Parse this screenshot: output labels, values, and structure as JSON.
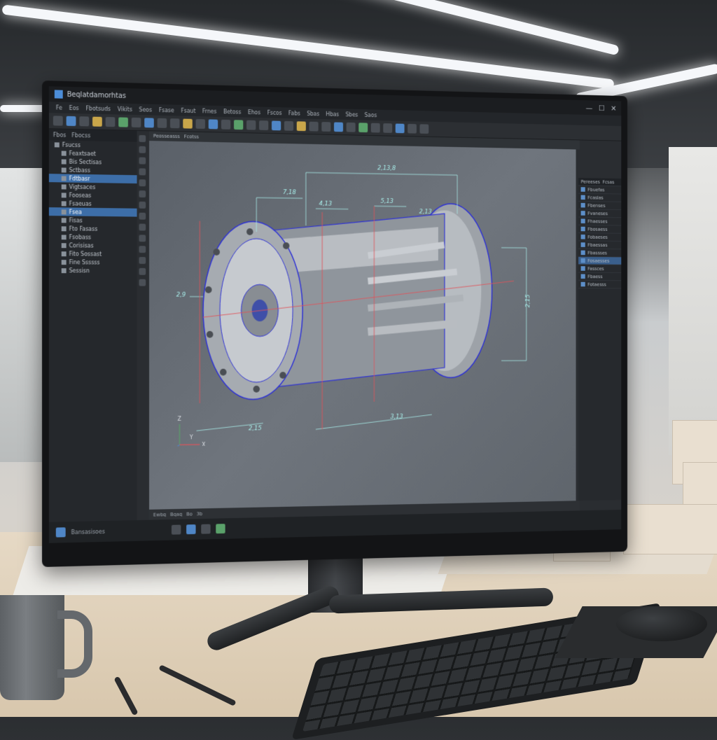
{
  "window": {
    "title": "Beqlatdamorhtas",
    "controls": [
      "—",
      "☐",
      "✕"
    ]
  },
  "menu": [
    "Fe",
    "Eos",
    "Fbotsuds",
    "Vikits",
    "Seos",
    "Fsase",
    "Fsaut",
    "Frnes",
    "Betoss",
    "Ehos",
    "Fscos",
    "Fabs",
    "Sbas",
    "Hbas",
    "Sbes",
    "Saos"
  ],
  "left_panel": {
    "tabs": [
      "Fbos",
      "Fbocss"
    ],
    "header": "Fsucss",
    "items": [
      {
        "label": "Feaxtsaet",
        "selected": false
      },
      {
        "label": "Bis Sectisas",
        "selected": false
      },
      {
        "label": "Sctbass",
        "selected": false
      },
      {
        "label": "Fdtbasr",
        "selected": true
      },
      {
        "label": "Vigtsaces",
        "selected": false
      },
      {
        "label": "Fooseas",
        "selected": false
      },
      {
        "label": "Fsaeuas",
        "selected": false
      },
      {
        "label": "Fsea",
        "selected": true
      },
      {
        "label": "Fisas",
        "selected": false
      },
      {
        "label": "Fto Fasass",
        "selected": false
      },
      {
        "label": "Fsobass",
        "selected": false
      },
      {
        "label": "Corisisas",
        "selected": false
      },
      {
        "label": "Fito Sossast",
        "selected": false
      },
      {
        "label": "Fine Ssssss",
        "selected": false
      },
      {
        "label": "Sessisn",
        "selected": false
      }
    ]
  },
  "viewport": {
    "tabs": [
      "Peosseasss",
      "Fcotss"
    ],
    "dimensions": [
      "2,13,8",
      "7,18",
      "4,13",
      "5,13",
      "2,13",
      "2,9",
      "2,15",
      "3,13",
      "2,15"
    ],
    "axis": [
      "Z",
      "X",
      "Y"
    ],
    "status": [
      "Ewbq",
      "Bqaq",
      "Bo",
      "3b"
    ]
  },
  "right_panel": {
    "tabs": [
      "Pereeses",
      "Fcsas"
    ],
    "rows": [
      "Fbuefas",
      "Fcaslas",
      "Fbenses",
      "Fvaneses",
      "Fhaesses",
      "Fbosaess",
      "Fobaeses",
      "Fbaessas",
      "Fbassses",
      "Fosaesses",
      "Fassces",
      "Fbaess",
      "Fotaesss"
    ]
  },
  "statusbar": {
    "left": "Bansasisoes"
  },
  "colors": {
    "accent": "#3d6ea8",
    "model_outline": "#2b2fd6",
    "dimension": "#a9f0ec",
    "red_line": "#e0545a"
  }
}
